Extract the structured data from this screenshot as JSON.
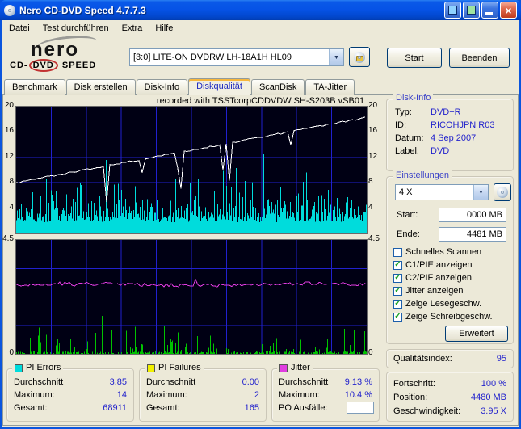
{
  "window": {
    "title": "Nero CD-DVD Speed 4.7.7.3"
  },
  "menu": {
    "items": [
      "Datei",
      "Test durchführen",
      "Extra",
      "Hilfe"
    ]
  },
  "logo": {
    "brand": "nero",
    "line2_prefix": "CD-",
    "line2_circled": "DVD",
    "line2_suffix": " SPEED"
  },
  "drive": {
    "value": "[3:0]   LITE-ON DVDRW LH-18A1H HL09"
  },
  "buttons": {
    "start": "Start",
    "quit": "Beenden"
  },
  "tabs": [
    {
      "label": "Benchmark",
      "active": false
    },
    {
      "label": "Disk erstellen",
      "active": false
    },
    {
      "label": "Disk-Info",
      "active": false
    },
    {
      "label": "Diskqualität",
      "active": true
    },
    {
      "label": "ScanDisk",
      "active": false
    },
    {
      "label": "TA-Jitter",
      "active": false
    }
  ],
  "chart": {
    "title": "recorded with TSSTcorpCDDVDW SH-S203B  vSB01",
    "top": {
      "ymax": 20,
      "ticks": [
        20,
        16,
        12,
        8,
        4
      ],
      "avg_line": 4,
      "speed_start": 8,
      "speed_end": 18.3,
      "pie_average": 3.85,
      "pie_max": 14
    },
    "bottom": {
      "ymax": 4.5,
      "top_label": "4.5",
      "zero_label": "0",
      "jitter_avg": 9.13,
      "jitter_max": 10.4,
      "jitter_axis_max": 15,
      "pif_max": 2
    },
    "colors": {
      "bg": "#000014",
      "grid": "#2121CE",
      "pie": "#00DCDC",
      "avg": "#00FFFF",
      "speed": "#FFFFFF",
      "pif": "#00C300",
      "jitter": "#E03CE0"
    },
    "seed": 20070904
  },
  "disk_info": {
    "title": "Disk-Info",
    "rows": [
      [
        "Typ:",
        "DVD+R"
      ],
      [
        "ID:",
        "RICOHJPN R03"
      ],
      [
        "Datum:",
        "4 Sep 2007"
      ],
      [
        "Label:",
        "DVD"
      ]
    ]
  },
  "settings": {
    "title": "Einstellungen",
    "speed": "4 X",
    "start_label": "Start:",
    "start_value": "0000 MB",
    "end_label": "Ende:",
    "end_value": "4481 MB",
    "checkboxes": [
      {
        "label": "Schnelles Scannen",
        "checked": false
      },
      {
        "label": "C1/PIE anzeigen",
        "checked": true
      },
      {
        "label": "C2/PIF anzeigen",
        "checked": true
      },
      {
        "label": "Jitter anzeigen",
        "checked": true
      },
      {
        "label": "Zeige Lesegeschw.",
        "checked": true
      },
      {
        "label": "Zeige Schreibgeschw.",
        "checked": true
      }
    ],
    "advanced_button": "Erweitert"
  },
  "quality": {
    "label": "Qualitätsindex:",
    "value": "95"
  },
  "stats": [
    {
      "title": "PI Errors",
      "color": "#00DCDC",
      "rows": [
        [
          "Durchschnitt",
          "3.85"
        ],
        [
          "Maximum:",
          "14"
        ],
        [
          "Gesamt:",
          "68911"
        ]
      ]
    },
    {
      "title": "PI Failures",
      "color": "#F0F000",
      "rows": [
        [
          "Durchschnitt",
          "0.00"
        ],
        [
          "Maximum:",
          "2"
        ],
        [
          "Gesamt:",
          "165"
        ]
      ]
    },
    {
      "title": "Jitter",
      "color": "#E03CE0",
      "rows": [
        [
          "Durchschnitt",
          "9.13 %"
        ],
        [
          "Maximum:",
          "10.4 %"
        ]
      ],
      "po_label": "PO Ausfälle:",
      "po_value": ""
    }
  ],
  "progress": {
    "rows": [
      [
        "Fortschritt:",
        "100 %"
      ],
      [
        "Position:",
        "4480 MB"
      ],
      [
        "Geschwindigkeit:",
        "3.95 X"
      ]
    ]
  }
}
